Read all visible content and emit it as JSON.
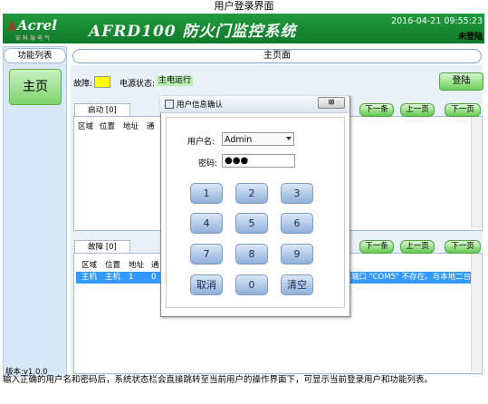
{
  "caption": "用户登录界面",
  "header": {
    "logo_text": "Acrel",
    "logo_subtext": "安科瑞电气",
    "system_title": "AFRD100 防火门监控系统",
    "datetime": "2016-04-21 09:55:23",
    "login_status": "未登陆"
  },
  "sidebar": {
    "function_list_label": "功能列表",
    "home_label": "主页",
    "version": "版本:v1.0.0"
  },
  "main": {
    "page_title": "主页面",
    "fault_label": "故障:",
    "power_label": "电源状态:",
    "power_value": "主电运行",
    "login_button": "登陆"
  },
  "start_panel": {
    "tab_label": "启动 [0]",
    "columns": [
      "区域",
      "位置",
      "地址",
      "通"
    ],
    "buttons": [
      "下一条",
      "上一页",
      "下一页"
    ]
  },
  "fault_panel": {
    "tab_label": "故障 [0]",
    "columns": [
      "区域",
      "位置",
      "地址",
      "通"
    ],
    "selected_row": {
      "cells": [
        "主机",
        "主机",
        "1",
        "0"
      ],
      "message": "端口 \"COM5\" 不存在。与本地二台"
    },
    "buttons": [
      "下一条",
      "上一页",
      "下一页"
    ]
  },
  "dialog": {
    "title": "用户信息确认",
    "close_symbol": "⊠",
    "username_label": "用户名:",
    "username_value": "Admin",
    "password_label": "密码:",
    "password_value": "●●●",
    "keys": [
      "1",
      "2",
      "3",
      "4",
      "5",
      "6",
      "7",
      "8",
      "9",
      "取消",
      "0",
      "清空"
    ]
  },
  "footer_note": "输入正确的用户名和密码后，系统状态栏会直接跳转至当前用户的操作界面下，可显示当前登录用户和功能列表。"
}
